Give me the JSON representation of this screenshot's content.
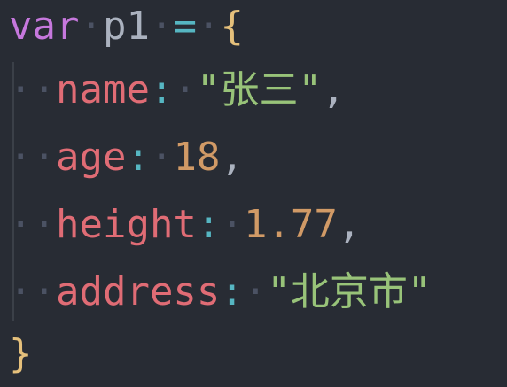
{
  "code": {
    "line1": {
      "keyword": "var",
      "ws1": "·",
      "identifier": "p1",
      "ws2": "·",
      "operator": "=",
      "ws3": "·",
      "brace_open": "{"
    },
    "line2": {
      "indent": "··",
      "key": "name",
      "colon": ":",
      "ws": "·",
      "value": "\"张三\"",
      "comma": ","
    },
    "line3": {
      "indent": "··",
      "key": "age",
      "colon": ":",
      "ws": "·",
      "value": "18",
      "comma": ","
    },
    "line4": {
      "indent": "··",
      "key": "height",
      "colon": ":",
      "ws": "·",
      "value": "1.77",
      "comma": ","
    },
    "line5": {
      "indent": "··",
      "key": "address",
      "colon": ":",
      "ws": "·",
      "value": "\"北京市\""
    },
    "line6": {
      "brace_close": "}"
    }
  },
  "colors": {
    "background": "#282c34",
    "keyword": "#c678dd",
    "property": "#e06c75",
    "string": "#98c379",
    "number": "#d19a66",
    "operator": "#56b6c2",
    "brace": "#e5c07b"
  }
}
